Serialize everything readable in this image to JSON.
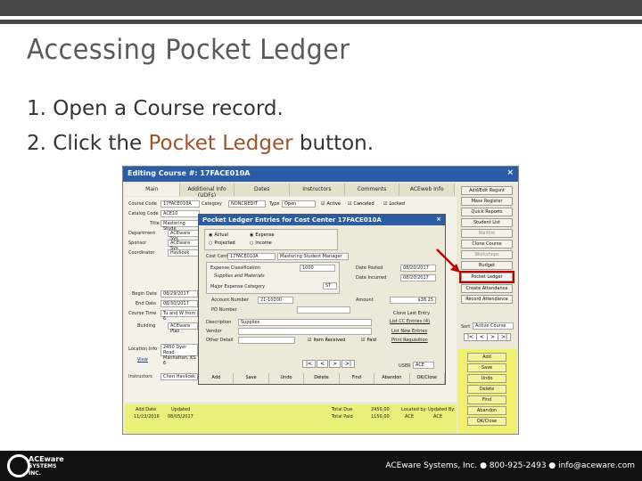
{
  "slide": {
    "title": "Accessing Pocket Ledger",
    "steps": [
      {
        "num": "1.",
        "text": "Open a Course record.",
        "pre": "",
        "hl": "",
        "post": ""
      },
      {
        "num": "2.",
        "text": "",
        "pre": "Click the ",
        "hl": "Pocket Ledger",
        "post": " button."
      }
    ],
    "footer": "ACEware Systems, Inc. ● 800-925-2493 ● info@aceware.com",
    "logo_lines": [
      "ACEware",
      "SYSTEMS",
      "INC."
    ]
  },
  "course_window": {
    "title": "Editing Course #: 17FACE010A",
    "close": "×",
    "tabs": [
      "Main",
      "Additional Info (UDFs)",
      "Dates",
      "Instructors",
      "Comments",
      "ACEweb Info"
    ],
    "fields": {
      "course_code_label": "Course Code",
      "course_code": "17FACE010A",
      "category_label": "Category",
      "category": "NONCREDIT",
      "type_label": "Type",
      "type": "Open",
      "active": "Active",
      "canceled": "Canceled",
      "locked": "Locked",
      "catalog_code_label": "Catalog Code",
      "catalog_code": "ACE10",
      "title_label": "Title",
      "title": "Mastering Stude",
      "department_label": "Department",
      "department": "ACEware Sys",
      "sponsor_label": "Sponsor",
      "sponsor": "ACEware Sys",
      "coordinator_label": "Coordinator",
      "coordinator": "Havlicek",
      "begin_date_label": "Begin Date",
      "begin_date": "08/29/2017",
      "end_date_label": "End Date",
      "end_date": "08/30/2017",
      "course_time_label": "Course Time",
      "course_time": "Tu and W from 6",
      "building_label": "Building",
      "building": "ACEware Plaz",
      "location_label": "Location Info",
      "location": "2450 Dyer Road Manhattan, KS 6",
      "view": "View",
      "instructors_label": "Instructors",
      "instructors": "Cheri Havlicek",
      "add_date_label": "Add Date",
      "add_date": "11/23/2016",
      "updated_label": "Updated",
      "updated": "08/05/2017",
      "total_due_label": "Total Due",
      "total_due": "2450.00",
      "total_paid_label": "Total Paid",
      "total_paid": "1150.00",
      "located_by_label": "Located by:",
      "located_by": "ACE",
      "updated_by_label": "Updated By:",
      "updated_by": "ACE"
    }
  },
  "side_buttons": [
    {
      "label": "Add/Edit Regsnt",
      "grey": false
    },
    {
      "label": "Mass Register",
      "grey": false
    },
    {
      "label": "Quick Reports",
      "grey": false
    },
    {
      "label": "Student List",
      "grey": false
    },
    {
      "label": "Waitlist",
      "grey": true
    },
    {
      "label": "Clone Course",
      "grey": false
    },
    {
      "label": "Workshops",
      "grey": true
    },
    {
      "label": "Budget",
      "grey": false
    },
    {
      "label": "Pocket Ledger",
      "grey": false
    },
    {
      "label": "Create Attendance",
      "grey": false
    },
    {
      "label": "Record Attendance",
      "grey": false
    }
  ],
  "sort": {
    "label": "Sort",
    "value": "Active Course",
    "nav": [
      "|<",
      "<",
      ">",
      ">|"
    ]
  },
  "action_buttons": [
    "Add",
    "Save",
    "Undo",
    "Delete",
    "Find",
    "Abandon",
    "OK/Close"
  ],
  "ledger": {
    "title": "Pocket Ledger Entries for Cost Center 17FACE010A",
    "close": "×",
    "actual": "Actual",
    "projected": "Projected",
    "expense": "Expense",
    "income": "Income",
    "cost_center_label": "Cost Center",
    "cost_center": "17FACE010A",
    "cost_center_desc": "Mastering Student Manager",
    "exp_class_label": "Expense Classification",
    "exp_class": "1000",
    "exp_class_desc": "Supplies and Materials",
    "major_cat_label": "Major Expense Category",
    "major_cat": "ST",
    "account_label": "Account Number",
    "account": "21-10200",
    "po_label": "PO Number",
    "date_posted_label": "Date Posted",
    "date_posted": "08/20/2017",
    "date_incurred_label": "Date Incurred",
    "date_incurred": "08/20/2017",
    "amount_label": "Amount",
    "amount": "$38.25",
    "description_label": "Description",
    "description": "Supplies",
    "vendor_label": "Vendor",
    "other_label": "Other Detail",
    "item_received": "Item Received",
    "paid": "Paid",
    "clone_last": "Clone Last Entry",
    "list_entries": "List CC Entries (4)",
    "list_new": "List New Entries",
    "print_req": "Print Requisition",
    "user_label": "USER",
    "user": "ACE",
    "nav": [
      "|<",
      "<",
      ">",
      ">|"
    ],
    "buttons": [
      "Add",
      "Save",
      "Undo",
      "Delete",
      "Find",
      "Abandon",
      "OK/Close"
    ]
  },
  "colors": {
    "accent": "#2a5ca8",
    "highlight": "#c00000",
    "step_highlight": "#a0522d"
  }
}
